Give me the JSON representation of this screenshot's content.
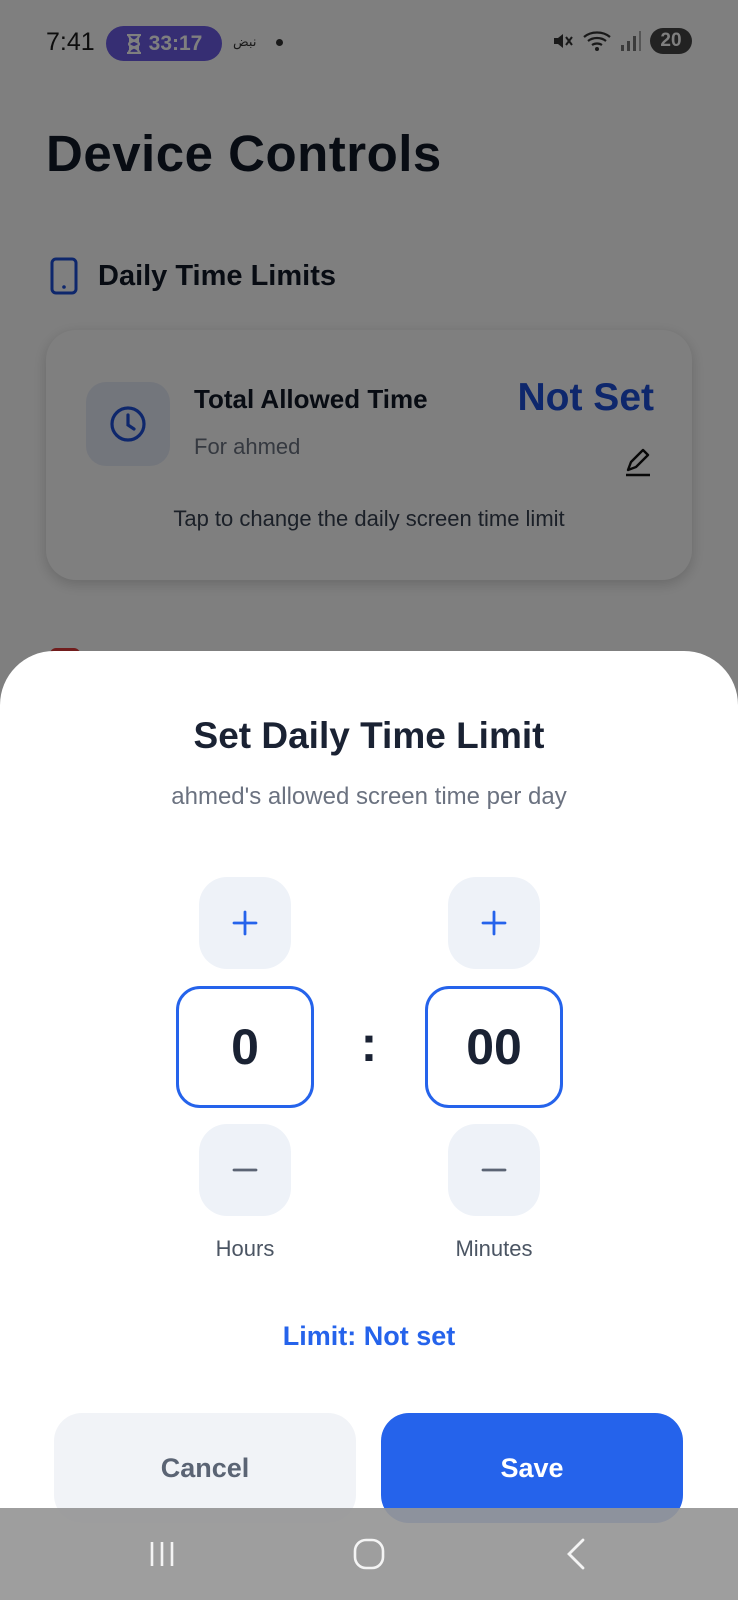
{
  "status_bar": {
    "time": "7:41",
    "timer": "33:17",
    "notification": "نبض",
    "battery": "20"
  },
  "page": {
    "title": "Device Controls",
    "section_title": "Daily Time Limits",
    "card": {
      "title": "Total Allowed Time",
      "subtitle": "For ahmed",
      "value": "Not Set",
      "hint": "Tap to change the daily screen time limit"
    }
  },
  "sheet": {
    "title": "Set Daily Time Limit",
    "subtitle": "ahmed's allowed screen time per day",
    "hours": {
      "value": "0",
      "label": "Hours"
    },
    "minutes": {
      "value": "00",
      "label": "Minutes"
    },
    "separator": ":",
    "limit_status": "Limit: Not set",
    "cancel_label": "Cancel",
    "save_label": "Save"
  },
  "colors": {
    "accent": "#2563eb",
    "card_value": "#1d4ed8",
    "timer_pill": "#6c5ce7",
    "scrim": "rgba(0,0,0,0.5)"
  },
  "icons": {
    "section": "phone-icon",
    "card": "clock-icon",
    "edit": "pencil-icon",
    "increment": "plus-icon",
    "decrement": "minus-icon"
  }
}
